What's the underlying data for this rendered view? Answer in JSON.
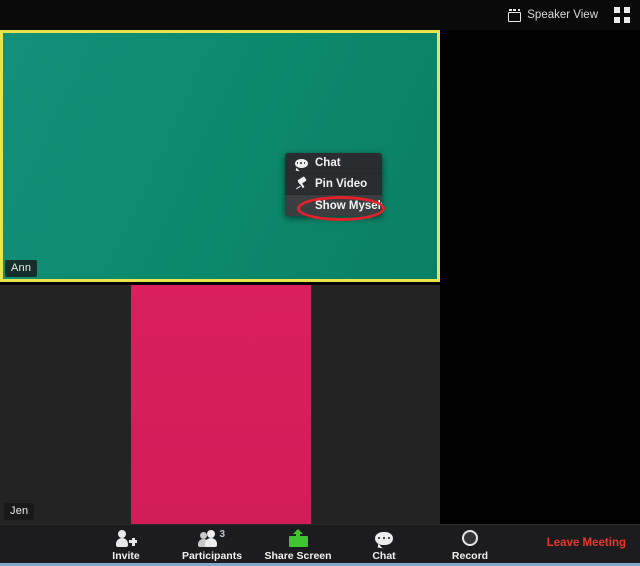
{
  "topbar": {
    "view_mode_label": "Speaker View",
    "view_mode_icon": "speaker-view-icon",
    "expand_icon": "fullscreen-expand-icon"
  },
  "stage": {
    "tiles": [
      {
        "name": "Ann",
        "state": "active-speaker",
        "highlight_color": "#e8e44a",
        "video_color": "#0e8a70"
      },
      {
        "name": "Jen",
        "state": "normal",
        "background_color": "#232323",
        "video_color": "#d91f5e"
      }
    ]
  },
  "context_menu": {
    "items": [
      {
        "label": "Chat",
        "icon": "chat-bubble-icon",
        "hovered": false
      },
      {
        "label": "Pin Video",
        "icon": "pin-icon",
        "hovered": false
      },
      {
        "label": "Show Myself",
        "icon": "",
        "hovered": true
      }
    ]
  },
  "annotation": {
    "type": "ellipse",
    "color": "#e4202a",
    "target_label": "Show Myself"
  },
  "toolbar": {
    "items": [
      {
        "label": "Invite",
        "icon": "invite-person-add-icon",
        "badge": ""
      },
      {
        "label": "Participants",
        "icon": "participants-people-icon",
        "badge": "3"
      },
      {
        "label": "Share Screen",
        "icon": "share-screen-icon",
        "badge": ""
      },
      {
        "label": "Chat",
        "icon": "chat-bubble-icon",
        "badge": ""
      },
      {
        "label": "Record",
        "icon": "record-circle-icon",
        "badge": ""
      }
    ],
    "leave_label": "Leave Meeting",
    "leave_color": "#e8372f"
  }
}
